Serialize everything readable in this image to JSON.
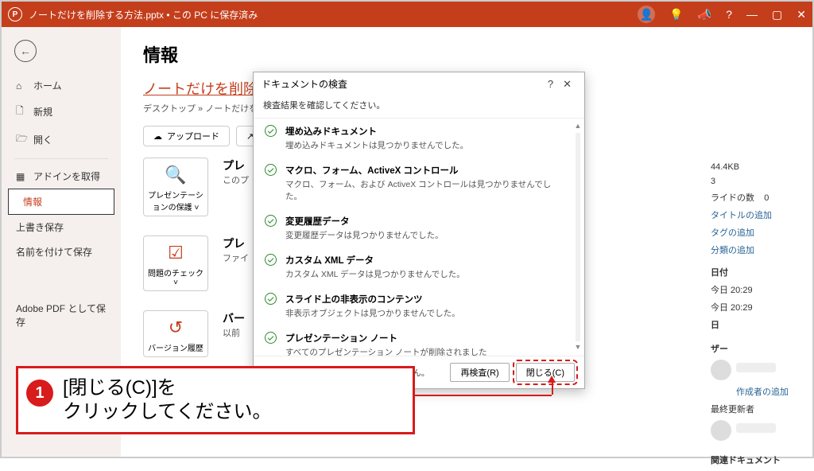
{
  "titlebar": {
    "filename": "ノートだけを削除する方法.pptx",
    "save_status": "この PC に保存済み"
  },
  "sidebar": {
    "home": "ホーム",
    "new": "新規",
    "open": "開く",
    "addin": "アドインを取得",
    "info": "情報",
    "overwrite": "上書き保存",
    "saveas": "名前を付けて保存",
    "adobe": "Adobe PDF として保存"
  },
  "content": {
    "heading": "情報",
    "file_title_link": "ノートだけを削除す",
    "breadcrumb_prefix": "デスクトップ » ",
    "breadcrumb_file": "ノートだけを削除す",
    "upload": "アップロード",
    "share": "共",
    "protect_btn": "プレゼンテーションの保護",
    "protect_title": "プレ",
    "protect_desc": "このプ",
    "inspect_btn": "問題のチェック",
    "inspect_title": "プレ",
    "inspect_desc": "ファイ",
    "version_btn": "バージョン履歴",
    "version_title": "バー",
    "version_desc": "以前"
  },
  "props": {
    "size": "44.4KB",
    "slides": "3",
    "hidden_slides_label": "ライドの数",
    "hidden_slides": "0",
    "title_add": "タイトルの追加",
    "tag_add": "タグの追加",
    "category_add": "分類の追加",
    "dates_label": "日付",
    "last_modified": "今日 20:29",
    "created": "今日 20:29",
    "day_label": "日",
    "user_section": "ザー",
    "author_add": "作成者の追加",
    "last_modifier": "最終更新者",
    "related_docs": "関連ドキュメント"
  },
  "dialog": {
    "title": "ドキュメントの検査",
    "subtitle": "検査結果を確認してください。",
    "items": [
      {
        "title": "埋め込みドキュメント",
        "desc": "埋め込みドキュメントは見つかりませんでした。"
      },
      {
        "title": "マクロ、フォーム、ActiveX コントロール",
        "desc": "マクロ、フォーム、および ActiveX コントロールは見つかりませんでした。"
      },
      {
        "title": "変更履歴データ",
        "desc": "変更履歴データは見つかりませんでした。"
      },
      {
        "title": "カスタム XML データ",
        "desc": "カスタム XML データは見つかりませんでした。"
      },
      {
        "title": "スライド上の非表示のコンテンツ",
        "desc": "非表示オブジェクトは見つかりませんでした。"
      },
      {
        "title": "プレゼンテーション ノート",
        "desc": "すべてのプレゼンテーション ノートが削除されました"
      }
    ],
    "warning": "注意: いくつかの変更は元に戻せません。",
    "reinspect": "再検査(R)",
    "close": "閉じる(C)"
  },
  "callout": {
    "number": "1",
    "text_line1": "[閉じる(C)]を",
    "text_line2": "クリックしてください。"
  }
}
